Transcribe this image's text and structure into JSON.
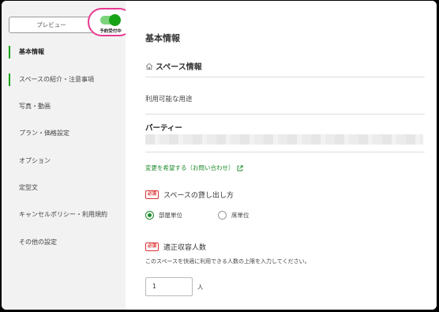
{
  "sidebar": {
    "preview_label": "プレビュー",
    "toggle_label": "予約受付中",
    "toggle_on": true,
    "items": [
      {
        "label": "基本情報"
      },
      {
        "label": "スペースの紹介・注意事項"
      },
      {
        "label": "写真・動画"
      },
      {
        "label": "プラン・価格設定"
      },
      {
        "label": "オプション"
      },
      {
        "label": "定型文"
      },
      {
        "label": "キャンセルポリシー・利用規約"
      },
      {
        "label": "その他の設定"
      }
    ]
  },
  "main": {
    "title": "基本情報",
    "section_title": "スペース情報",
    "usage_label": "利用可能な用途",
    "usage_value": "パーティー",
    "change_link": "変更を希望する（お問い合わせ）",
    "rental_label": "スペースの貸し出し方",
    "required_badge": "必須",
    "rental_options": [
      {
        "label": "部屋単位",
        "selected": true
      },
      {
        "label": "席単位",
        "selected": false
      }
    ],
    "capacity_label": "適正収容人数",
    "capacity_hint": "このスペースを快適に利用できる人数の上限を入力してください。",
    "capacity_value": "1",
    "capacity_unit": "人"
  },
  "colors": {
    "accent_green": "#16a316",
    "highlight_pink": "#e8388f",
    "required_red": "#d33333"
  }
}
